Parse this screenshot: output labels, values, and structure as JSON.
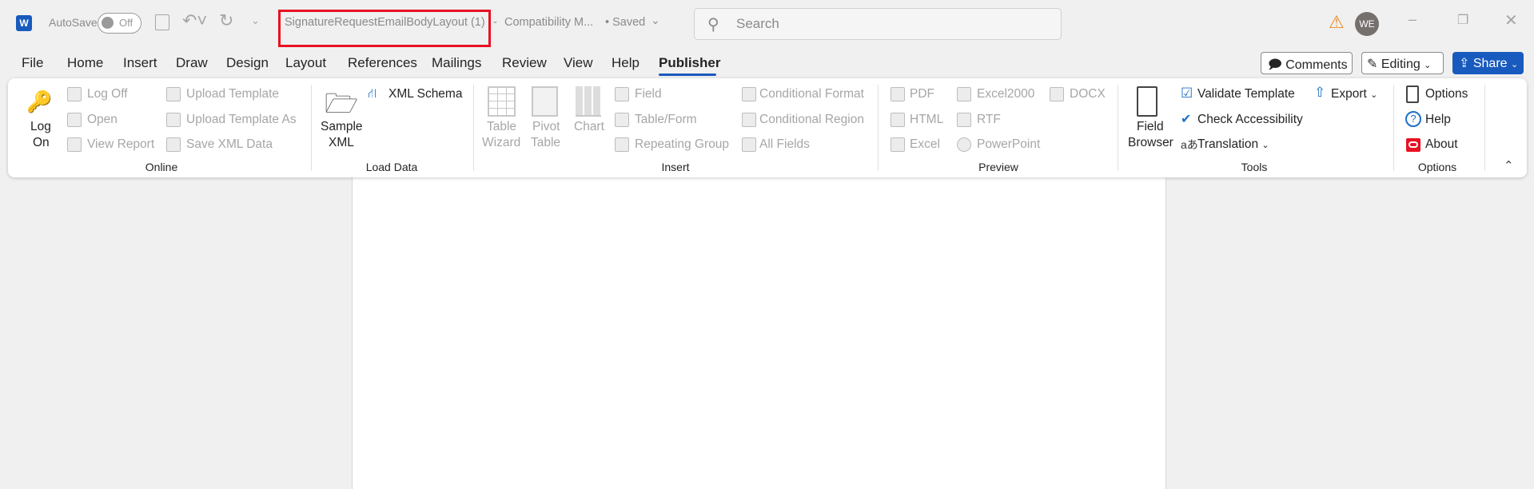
{
  "titlebar": {
    "autosave_label": "AutoSave",
    "autosave_state": "Off",
    "doc_title": "SignatureRequestEmailBodyLayout (1)",
    "separator": "-",
    "mode": "Compatibility M...",
    "save_status": "• Saved",
    "search_placeholder": "Search",
    "avatar_initials": "WE"
  },
  "tabs": [
    "File",
    "Home",
    "Insert",
    "Draw",
    "Design",
    "Layout",
    "References",
    "Mailings",
    "Review",
    "View",
    "Help",
    "Publisher"
  ],
  "actions": {
    "comments": "Comments",
    "editing": "Editing",
    "share": "Share"
  },
  "ribbon": {
    "online": {
      "label": "Online",
      "log_on": [
        "Log",
        "On"
      ],
      "log_off": "Log Off",
      "open": "Open",
      "view_report": "View Report",
      "upload_template": "Upload Template",
      "upload_template_as": "Upload Template As",
      "save_xml": "Save XML Data"
    },
    "load_data": {
      "label": "Load Data",
      "sample_xml": [
        "Sample",
        "XML"
      ],
      "xml_schema": "XML Schema"
    },
    "insert": {
      "label": "Insert",
      "table_wizard": [
        "Table",
        "Wizard"
      ],
      "pivot_table": [
        "Pivot",
        "Table"
      ],
      "chart": "Chart",
      "field": "Field",
      "table_form": "Table/Form",
      "repeating_group": "Repeating Group",
      "conditional_format": "Conditional Format",
      "conditional_region": "Conditional Region",
      "all_fields": "All Fields"
    },
    "preview": {
      "label": "Preview",
      "pdf": "PDF",
      "html": "HTML",
      "excel": "Excel",
      "excel2000": "Excel2000",
      "rtf": "RTF",
      "powerpoint": "PowerPoint",
      "docx": "DOCX"
    },
    "tools": {
      "label": "Tools",
      "field_browser": [
        "Field",
        "Browser"
      ],
      "validate": "Validate Template",
      "accessibility": "Check Accessibility",
      "translation": "Translation",
      "export": "Export"
    },
    "options": {
      "label": "Options",
      "options": "Options",
      "help": "Help",
      "about": "About"
    }
  },
  "colors": {
    "accent": "#185abd",
    "highlight": "#e81123"
  }
}
